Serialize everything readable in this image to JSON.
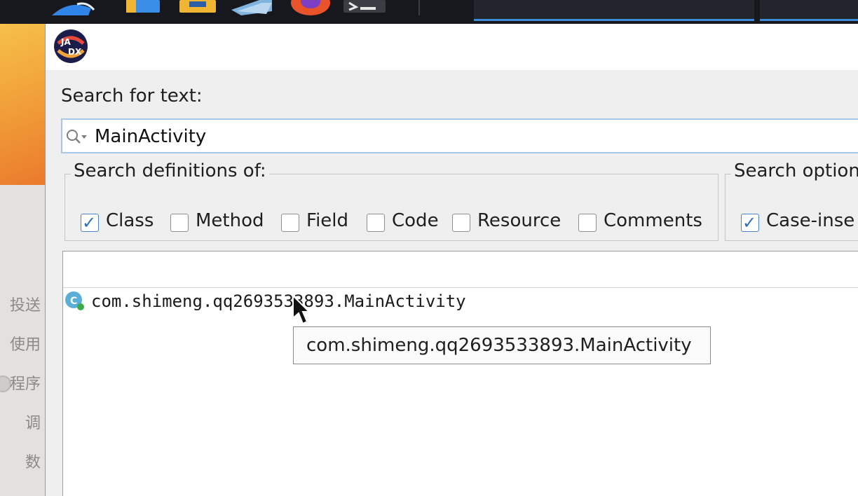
{
  "desktop": {
    "side_texts": [
      "投送",
      "使用",
      "程序",
      "调",
      "数"
    ]
  },
  "dialog": {
    "search_label": "Search for text:",
    "search_value": "MainActivity",
    "definitions_legend": "Search definitions of:",
    "definitions": [
      {
        "label": "Class",
        "checked": true
      },
      {
        "label": "Method",
        "checked": false
      },
      {
        "label": "Field",
        "checked": false
      },
      {
        "label": "Code",
        "checked": false
      },
      {
        "label": "Resource",
        "checked": false
      },
      {
        "label": "Comments",
        "checked": false
      }
    ],
    "options_legend": "Search option",
    "options": [
      {
        "label": "Case-inse",
        "checked": true
      }
    ],
    "results": [
      {
        "text": "com.shimeng.qq2693533893.MainActivity",
        "icon": "class-icon"
      }
    ],
    "tooltip": "com.shimeng.qq2693533893.MainActivity",
    "checkmark": "✓"
  },
  "colors": {
    "accent": "#3f8bd8",
    "checkbox_tick": "#2f6fb6",
    "class_icon": "#5aaed8",
    "class_badge": "#3cab45",
    "wallpaper": "#f2a23a"
  }
}
